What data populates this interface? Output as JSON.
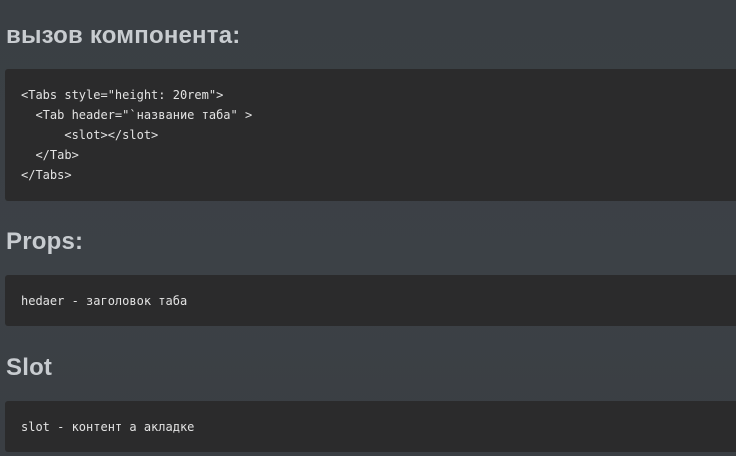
{
  "sections": [
    {
      "title": "вызов компонента:",
      "code": [
        "<Tabs style=\"height: 20rem\">",
        "  <Tab header=\"`название таба\" >",
        "      <slot></slot>",
        "  </Tab>",
        "</Tabs>"
      ]
    },
    {
      "title": "Props:",
      "code": [
        "hedaer - заголовок таба"
      ]
    },
    {
      "title": "Slot",
      "code": [
        "slot - контент а акладке"
      ]
    }
  ]
}
